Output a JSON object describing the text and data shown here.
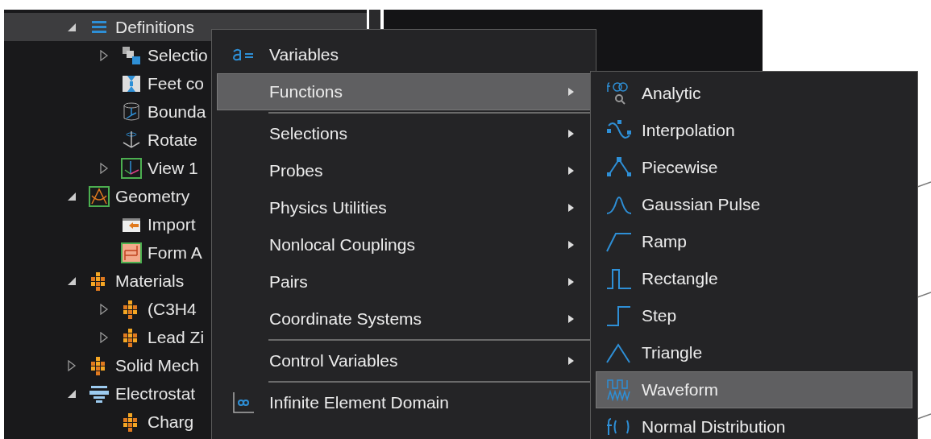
{
  "tree": [
    {
      "label": "Definitions",
      "kind": "branch",
      "expanded": true,
      "selected": true,
      "children": [
        {
          "label": "Selectio",
          "kind": "branch",
          "expanded": false,
          "selected": false
        },
        {
          "label": "Feet co",
          "kind": "leaf",
          "selected": false
        },
        {
          "label": "Bounda",
          "kind": "leaf",
          "selected": false
        },
        {
          "label": "Rotate",
          "kind": "leaf",
          "selected": false
        },
        {
          "label": "View 1",
          "kind": "branch",
          "expanded": false,
          "selected": false
        }
      ]
    },
    {
      "label": "Geometry",
      "kind": "branch",
      "expanded": true,
      "selected": false,
      "children": [
        {
          "label": "Import",
          "kind": "leaf",
          "selected": false
        },
        {
          "label": "Form A",
          "kind": "leaf",
          "selected": false
        }
      ]
    },
    {
      "label": "Materials",
      "kind": "branch",
      "expanded": true,
      "selected": false,
      "children": [
        {
          "label": "(C3H4",
          "kind": "branch",
          "expanded": false,
          "selected": false
        },
        {
          "label": "Lead Zi",
          "kind": "branch",
          "expanded": false,
          "selected": false
        }
      ]
    },
    {
      "label": "Solid Mech",
      "kind": "branch",
      "expanded": false,
      "selected": false
    },
    {
      "label": "Electrostat",
      "kind": "branch",
      "expanded": true,
      "selected": false,
      "children": [
        {
          "label": "Charg",
          "kind": "leaf",
          "selected": false
        }
      ]
    }
  ],
  "context_menu": [
    {
      "kind": "item",
      "label": "Variables",
      "submenu": false,
      "selected": false
    },
    {
      "kind": "item",
      "label": "Functions",
      "submenu": true,
      "selected": true
    },
    {
      "kind": "separator"
    },
    {
      "kind": "item",
      "label": "Selections",
      "submenu": true,
      "selected": false
    },
    {
      "kind": "item",
      "label": "Probes",
      "submenu": true,
      "selected": false
    },
    {
      "kind": "item",
      "label": "Physics Utilities",
      "submenu": true,
      "selected": false
    },
    {
      "kind": "item",
      "label": "Nonlocal Couplings",
      "submenu": true,
      "selected": false
    },
    {
      "kind": "item",
      "label": "Pairs",
      "submenu": true,
      "selected": false
    },
    {
      "kind": "item",
      "label": "Coordinate Systems",
      "submenu": true,
      "selected": false
    },
    {
      "kind": "separator"
    },
    {
      "kind": "item",
      "label": "Control Variables",
      "submenu": true,
      "selected": false
    },
    {
      "kind": "separator"
    },
    {
      "kind": "item",
      "label": "Infinite Element Domain",
      "submenu": false,
      "selected": false
    }
  ],
  "functions_submenu": [
    {
      "label": "Analytic",
      "selected": false
    },
    {
      "label": "Interpolation",
      "selected": false
    },
    {
      "label": "Piecewise",
      "selected": false
    },
    {
      "label": "Gaussian Pulse",
      "selected": false
    },
    {
      "label": "Ramp",
      "selected": false
    },
    {
      "label": "Rectangle",
      "selected": false
    },
    {
      "label": "Step",
      "selected": false
    },
    {
      "label": "Triangle",
      "selected": false
    },
    {
      "label": "Waveform",
      "selected": true
    },
    {
      "label": "Normal Distribution",
      "selected": false
    }
  ]
}
